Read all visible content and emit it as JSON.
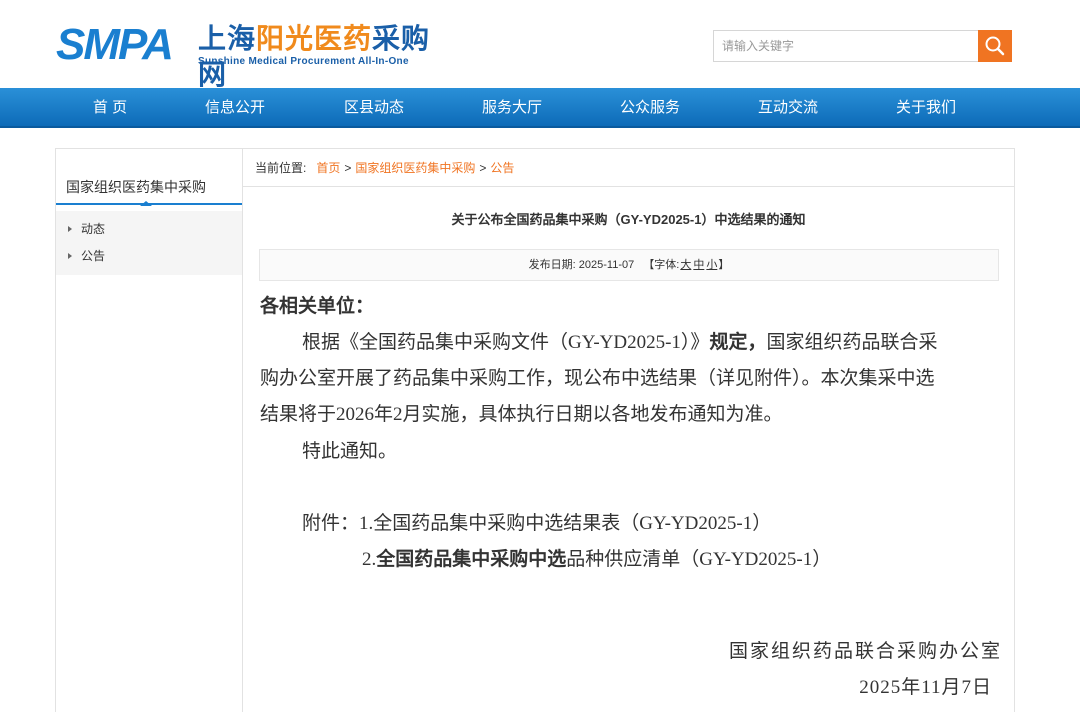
{
  "header": {
    "logo_smpa": "SMPA",
    "logo_cn_part1": "上海",
    "logo_cn_part2": "阳光医药",
    "logo_cn_part3": "采购网",
    "logo_en": "Sunshine Medical Procurement All-In-One",
    "search_placeholder": "请输入关键字",
    "search_icon": "magnifier-icon"
  },
  "nav": {
    "items": [
      "首 页",
      "信息公开",
      "区县动态",
      "服务大厅",
      "公众服务",
      "互动交流",
      "关于我们"
    ]
  },
  "sidebar": {
    "title": "国家组织医药集中采购",
    "items": [
      "动态",
      "公告"
    ]
  },
  "breadcrumb": {
    "prefix": "当前位置:",
    "items": [
      "首页",
      "国家组织医药集中采购",
      "公告"
    ],
    "separator": ">"
  },
  "article": {
    "title": "关于公布全国药品集中采购（GY-YD2025-1）中选结果的通知",
    "meta_date_label": "发布日期:",
    "meta_date": "2025-11-07",
    "meta_font_label": "【字体:",
    "meta_font_large": "大",
    "meta_font_medium": "中",
    "meta_font_small": "小",
    "meta_font_close": "】",
    "salutation": "各相关单位：",
    "p1_line1_a": "根据《全国药品集中采购文件（GY-YD2025-1）》",
    "p1_line1_b": "规定，",
    "p1_line1_c": "国家组织药品联合采",
    "p1_line2": "购办公室开展了药品集中采购工作，现公布中选结果（详见附件）。本次集采中选",
    "p1_line3": "结果将于2026年2月实施，具体执行日期以各地发布通知为准。",
    "p2": "特此通知。",
    "attach_label": "附件：",
    "attach1": "1.全国药品集中采购中选结果表（GY-YD2025-1）",
    "attach2_a": "2.",
    "attach2_b": "全国药品集中采购中选",
    "attach2_c": "品种供应清单（GY-YD2025-1）",
    "sign_org": "国家组织药品联合采购办公室",
    "sign_date": "2025年11月7日"
  },
  "colors": {
    "brand_blue": "#1a7fd0",
    "accent_orange": "#f07422",
    "nav_blue": "#0d6bb8"
  }
}
